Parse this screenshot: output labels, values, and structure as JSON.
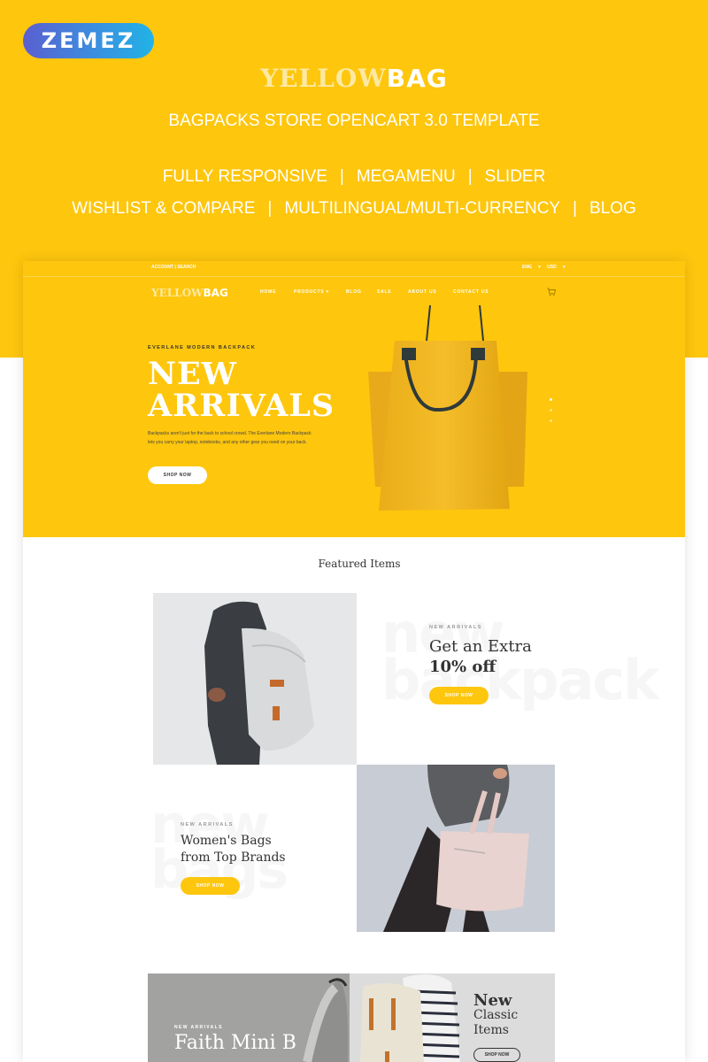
{
  "brand": {
    "badge": "ZEMEZ"
  },
  "promo": {
    "title_part1": "YELLOW",
    "title_part2": "BAG",
    "subtitle": "BAGPACKS STORE OPENCART 3.0 TEMPLATE",
    "features_row1": [
      "FULLY RESPONSIVE",
      "MEGAMENU",
      "SLIDER"
    ],
    "features_row2": [
      "WISHLIST & COMPARE",
      "MULTILINGUAL/MULTI-CURRENCY",
      "BLOG"
    ],
    "separator": "|"
  },
  "store": {
    "topbar": {
      "account": "ACCOUNT",
      "search": "SEARCH",
      "language": "ENG",
      "currency": "USD"
    },
    "logo_part1": "YELLOW",
    "logo_part2": "BAG",
    "nav": [
      "HOME",
      "PRODUCTS",
      "BLOG",
      "SALE",
      "ABOUT US",
      "CONTACT US"
    ],
    "cart_icon": "shopping-cart-icon"
  },
  "hero": {
    "kicker": "EVERLANE MODERN BACKPACK",
    "title_line1": "NEW",
    "title_line2": "ARRIVALS",
    "description": "Backpacks aren't just for the back to school crowd. The Everlane Modern Backpack lets you carry your laptop, notebooks, and any other gear you need on your back.",
    "button": "SHOP NOW",
    "slides": 3,
    "active_slide": 1
  },
  "featured": {
    "title": "Featured Items",
    "cards": [
      {
        "ghost": "new backpack",
        "kicker": "NEW ARRIVALS",
        "title_line1": "Get an Extra",
        "title_line2": "10% off",
        "button": "SHOP NOW"
      },
      {
        "ghost": "new bags",
        "kicker": "NEW ARRIVALS",
        "title_line1": "Women's Bags",
        "title_line2": "from Top Brands",
        "button": "SHOP NOW"
      }
    ]
  },
  "banners": [
    {
      "kicker": "NEW ARRIVALS",
      "title": "Faith Mini B"
    },
    {
      "title_bold": "New",
      "title_line2": "Classic",
      "title_line3": "Items",
      "button": "SHOP NOW"
    }
  ],
  "colors": {
    "accent": "#fec60d",
    "text_dark": "#333333",
    "zemez_start": "#5a5fd0",
    "zemez_end": "#21b3e6"
  }
}
